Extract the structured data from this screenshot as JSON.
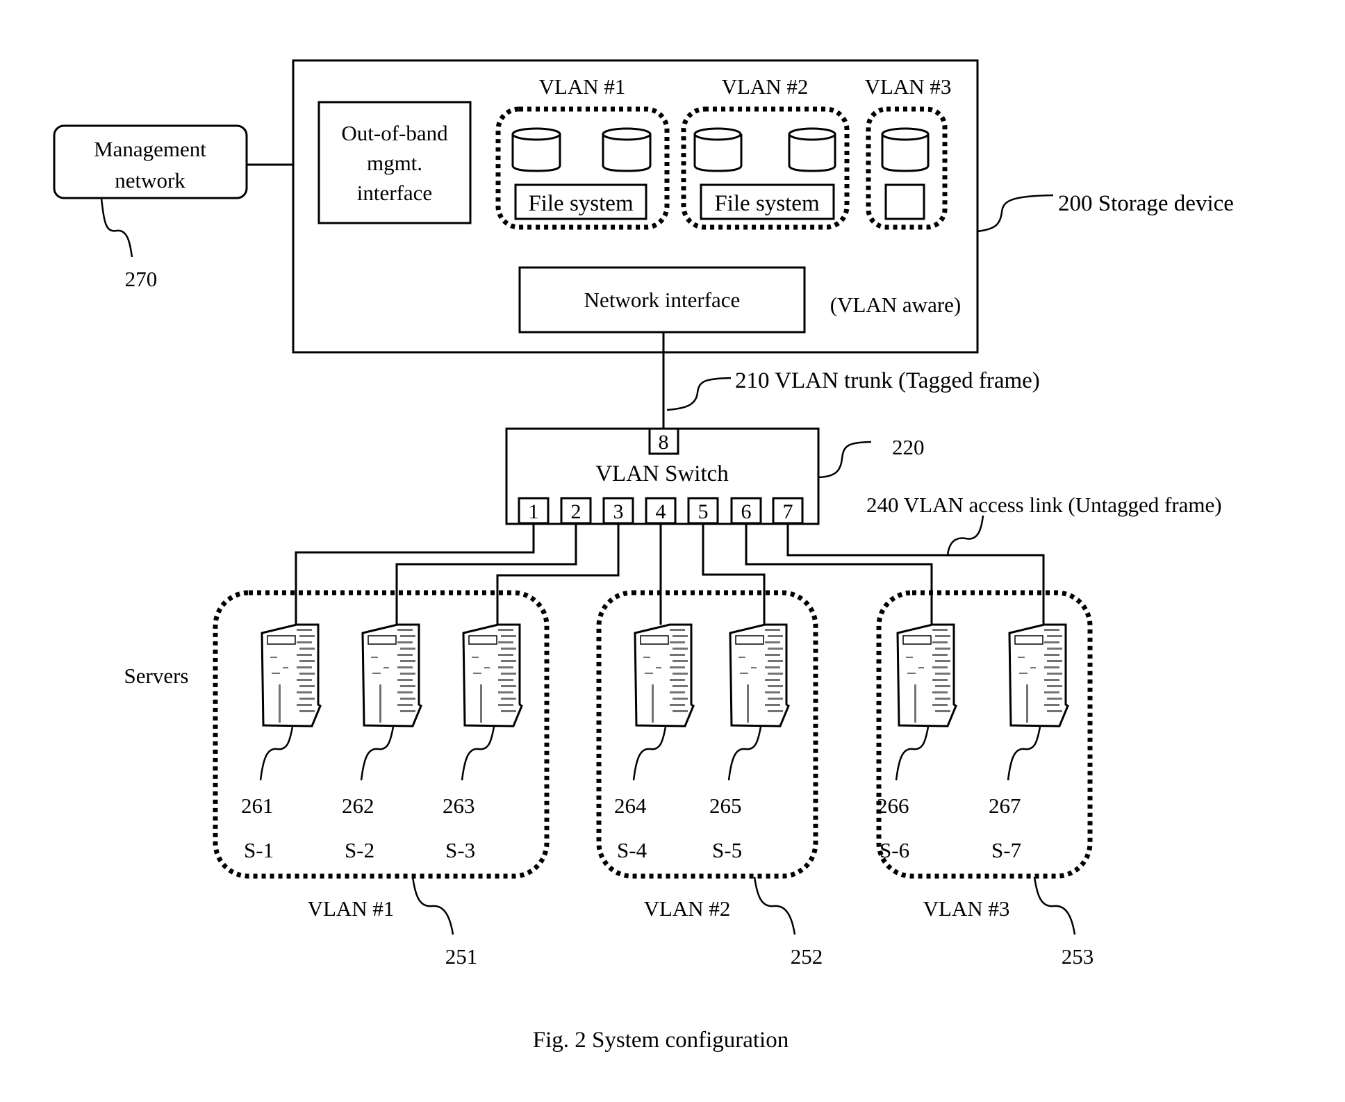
{
  "figure": {
    "caption": "Fig. 2 System configuration"
  },
  "management_network": {
    "label_line1": "Management",
    "label_line2": "network",
    "ref": "270"
  },
  "storage_device": {
    "ref_label": "200 Storage device",
    "oob_interface": {
      "line1": "Out-of-band",
      "line2": "mgmt.",
      "line3": "interface"
    },
    "network_interface": "Network interface",
    "vlan_aware": "(VLAN aware)",
    "vlans": [
      {
        "label": "VLAN #1",
        "volumes": 2,
        "fs_label": "File system"
      },
      {
        "label": "VLAN #2",
        "volumes": 2,
        "fs_label": "File system"
      },
      {
        "label": "VLAN #3",
        "volumes": 1,
        "fs_label": ""
      }
    ]
  },
  "trunk": {
    "label": "210 VLAN trunk (Tagged frame)"
  },
  "switch": {
    "label": "VLAN Switch",
    "ref": "220",
    "uplink_port": "8",
    "ports": [
      "1",
      "2",
      "3",
      "4",
      "5",
      "6",
      "7"
    ]
  },
  "access_link": {
    "label": "240 VLAN access link (Untagged frame)"
  },
  "servers_label": "Servers",
  "server_groups": [
    {
      "label": "VLAN #1",
      "ref": "251",
      "servers": [
        {
          "ref": "261",
          "name": "S-1",
          "port": "1"
        },
        {
          "ref": "262",
          "name": "S-2",
          "port": "2"
        },
        {
          "ref": "263",
          "name": "S-3",
          "port": "3"
        }
      ]
    },
    {
      "label": "VLAN #2",
      "ref": "252",
      "servers": [
        {
          "ref": "264",
          "name": "S-4",
          "port": "4"
        },
        {
          "ref": "265",
          "name": "S-5",
          "port": "5"
        }
      ]
    },
    {
      "label": "VLAN #3",
      "ref": "253",
      "servers": [
        {
          "ref": "266",
          "name": "S-6",
          "port": "6"
        },
        {
          "ref": "267",
          "name": "S-7",
          "port": "7"
        }
      ]
    }
  ]
}
